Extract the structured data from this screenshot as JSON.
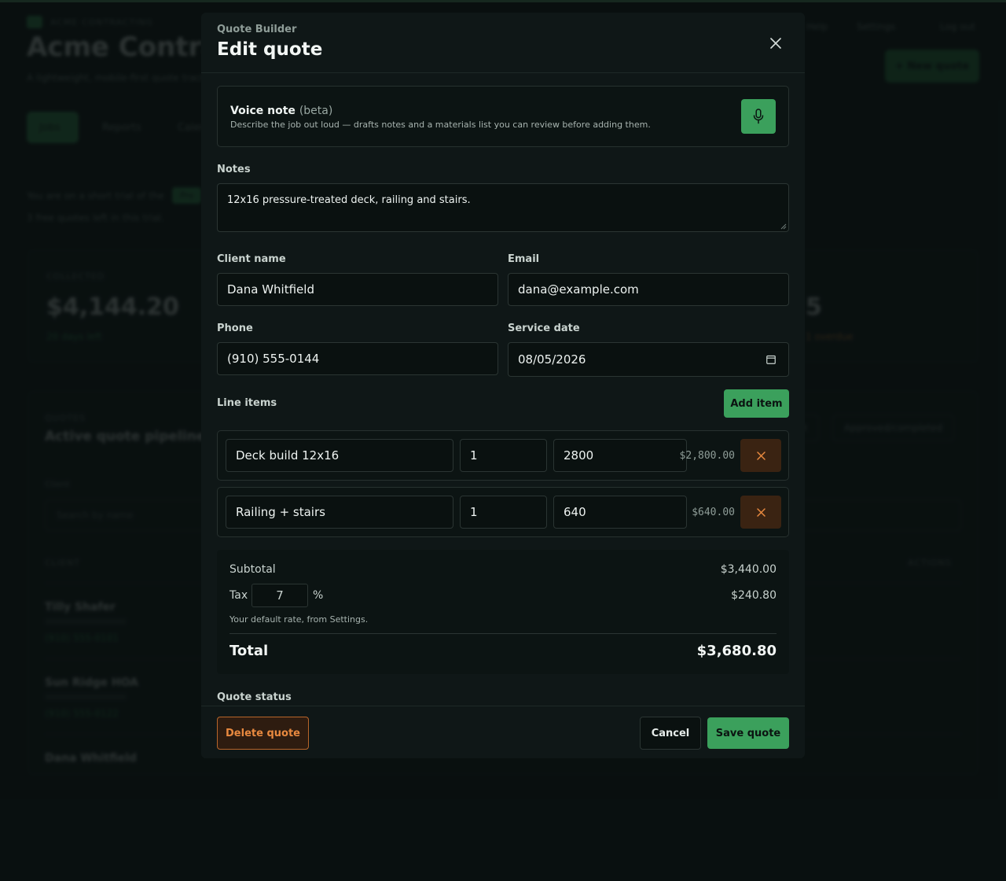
{
  "background": {
    "brand_small": "ACME CONTRACTING",
    "app_title": "Acme Contracting",
    "app_subtitle": "A lightweight, mobile-first quote tracker for contractors.",
    "nav": {
      "help": "Help",
      "settings": "Settings",
      "logout": "Log out"
    },
    "new_quote_button": "+ New quote",
    "tabs": [
      "Jobs",
      "Reports",
      "Calendar"
    ],
    "plan_text": "You are on a short trial of the",
    "plan_badge": "Pro",
    "plan_text2": "3 free quotes left in this trial.",
    "stat_label": "COLLECTED",
    "stat_value": "$4,144.20",
    "stat_note": "20 days left",
    "stat_value2": "5",
    "stat_note2": "1 overdue",
    "pipeline_label": "QUOTES",
    "pipeline_title": "Active quote pipeline",
    "filters": [
      "Sent",
      "Approved/completed"
    ],
    "search_label": "Client",
    "search_placeholder": "Search by name",
    "col_client": "CLIENT",
    "col_actions": "ACTIONS",
    "rows": [
      {
        "name": "Tilly Shafer",
        "phone": "(910) 555-0101"
      },
      {
        "name": "Sun Ridge HOA",
        "phone": "(910) 555-0122"
      },
      {
        "name": "Dana Whitfield",
        "phone": ""
      }
    ]
  },
  "modal": {
    "eyebrow": "Quote Builder",
    "title": "Edit quote",
    "voice": {
      "title": "Voice note",
      "beta": "(beta)",
      "description": "Describe the job out loud — drafts notes and a materials list you can review before adding them."
    },
    "notes_label": "Notes",
    "notes_value": "12x16 pressure-treated deck, railing and stairs.",
    "client_name_label": "Client name",
    "client_name_value": "Dana Whitfield",
    "email_label": "Email",
    "email_value": "dana@example.com",
    "phone_label": "Phone",
    "phone_value": "(910) 555-0144",
    "service_date_label": "Service date",
    "service_date_value": "08/05/2026",
    "line_items_label": "Line items",
    "add_item_button": "Add item",
    "line_items": [
      {
        "description": "Deck build 12x16",
        "qty": "1",
        "price": "2800",
        "amount": "$2,800.00"
      },
      {
        "description": "Railing + stairs",
        "qty": "1",
        "price": "640",
        "amount": "$640.00"
      }
    ],
    "subtotal_label": "Subtotal",
    "subtotal_value": "$3,440.00",
    "tax_label": "Tax",
    "tax_rate": "7",
    "tax_percent_sign": "%",
    "tax_value": "$240.80",
    "tax_hint": "Your default rate, from Settings.",
    "total_label": "Total",
    "total_value": "$3,680.80",
    "quote_status_label": "Quote status",
    "delete_button": "Delete quote",
    "cancel_button": "Cancel",
    "save_button": "Save quote"
  },
  "colors": {
    "accent_green": "#3ba05c",
    "danger_orange": "#e8893f",
    "background": "#0b1212",
    "modal_background": "#0f1717"
  },
  "icons": {
    "close": "close-icon",
    "mic": "microphone-icon",
    "remove": "x-icon",
    "calendar": "calendar-icon"
  }
}
